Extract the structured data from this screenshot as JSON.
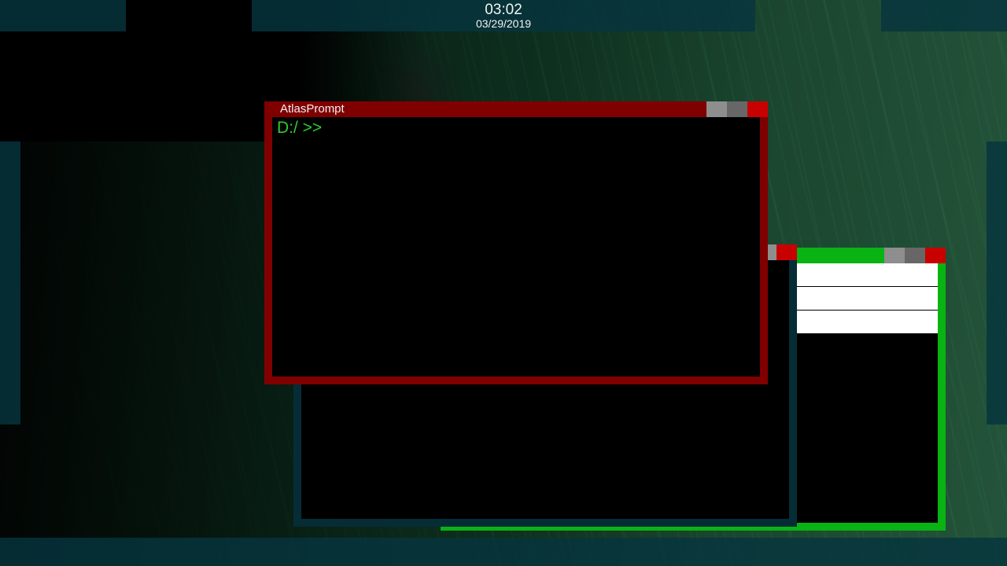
{
  "top_bar": {
    "time": "03:02",
    "date": "03/29/2019"
  },
  "terminal_window": {
    "title": "AtlasPrompt",
    "prompt": "D:/ >>",
    "controls": [
      "minimize",
      "maximize",
      "close"
    ],
    "frame_color": "#800000",
    "prompt_color": "#2ecc2e"
  },
  "green_window": {
    "frame_color": "#08b313",
    "controls": [
      "minimize",
      "maximize",
      "close"
    ],
    "list_rows": [
      "",
      "",
      ""
    ]
  },
  "teal_window": {
    "frame_color": "#062c36",
    "controls": [
      "close"
    ]
  },
  "colors": {
    "panel": "#06343e",
    "close_button": "#c80000",
    "min_button": "#8e8e8e",
    "max_button": "#676767"
  }
}
